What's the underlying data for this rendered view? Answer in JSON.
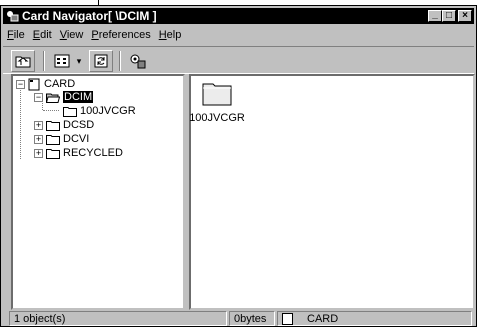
{
  "window": {
    "title": "Card Navigator[ \\DCIM ]"
  },
  "caption_buttons": {
    "minimize": "_",
    "maximize": "□",
    "close": "×"
  },
  "menu": [
    {
      "label": "File",
      "key": "F",
      "rest": "ile"
    },
    {
      "label": "Edit",
      "key": "E",
      "rest": "dit"
    },
    {
      "label": "View",
      "key": "V",
      "rest": "iew"
    },
    {
      "label": "Preferences",
      "key": "P",
      "rest": "references"
    },
    {
      "label": "Help",
      "key": "H",
      "rest": "elp"
    }
  ],
  "toolbar": {
    "icons": [
      "up-folder-icon",
      "view-mode-icon",
      "refresh-icon",
      "card-settings-icon"
    ],
    "dropdown_arrow": "▾"
  },
  "tree": {
    "root": {
      "label": "CARD",
      "expander": "−"
    },
    "items": [
      {
        "label": "DCIM",
        "expander": "−",
        "selected": true
      },
      {
        "label": "100JVCGR"
      },
      {
        "label": "DCSD",
        "expander": "+"
      },
      {
        "label": "DCVI",
        "expander": "+"
      },
      {
        "label": "RECYCLED",
        "expander": "+"
      }
    ]
  },
  "list": {
    "items": [
      {
        "label": "100JVCGR",
        "icon": "folder-icon"
      }
    ]
  },
  "status": {
    "objects": "1 object(s)",
    "size": "0bytes",
    "drive": "CARD"
  },
  "colors": {
    "face": "#c0c0c0",
    "title_bg": "#000000",
    "selection": "#000000"
  }
}
